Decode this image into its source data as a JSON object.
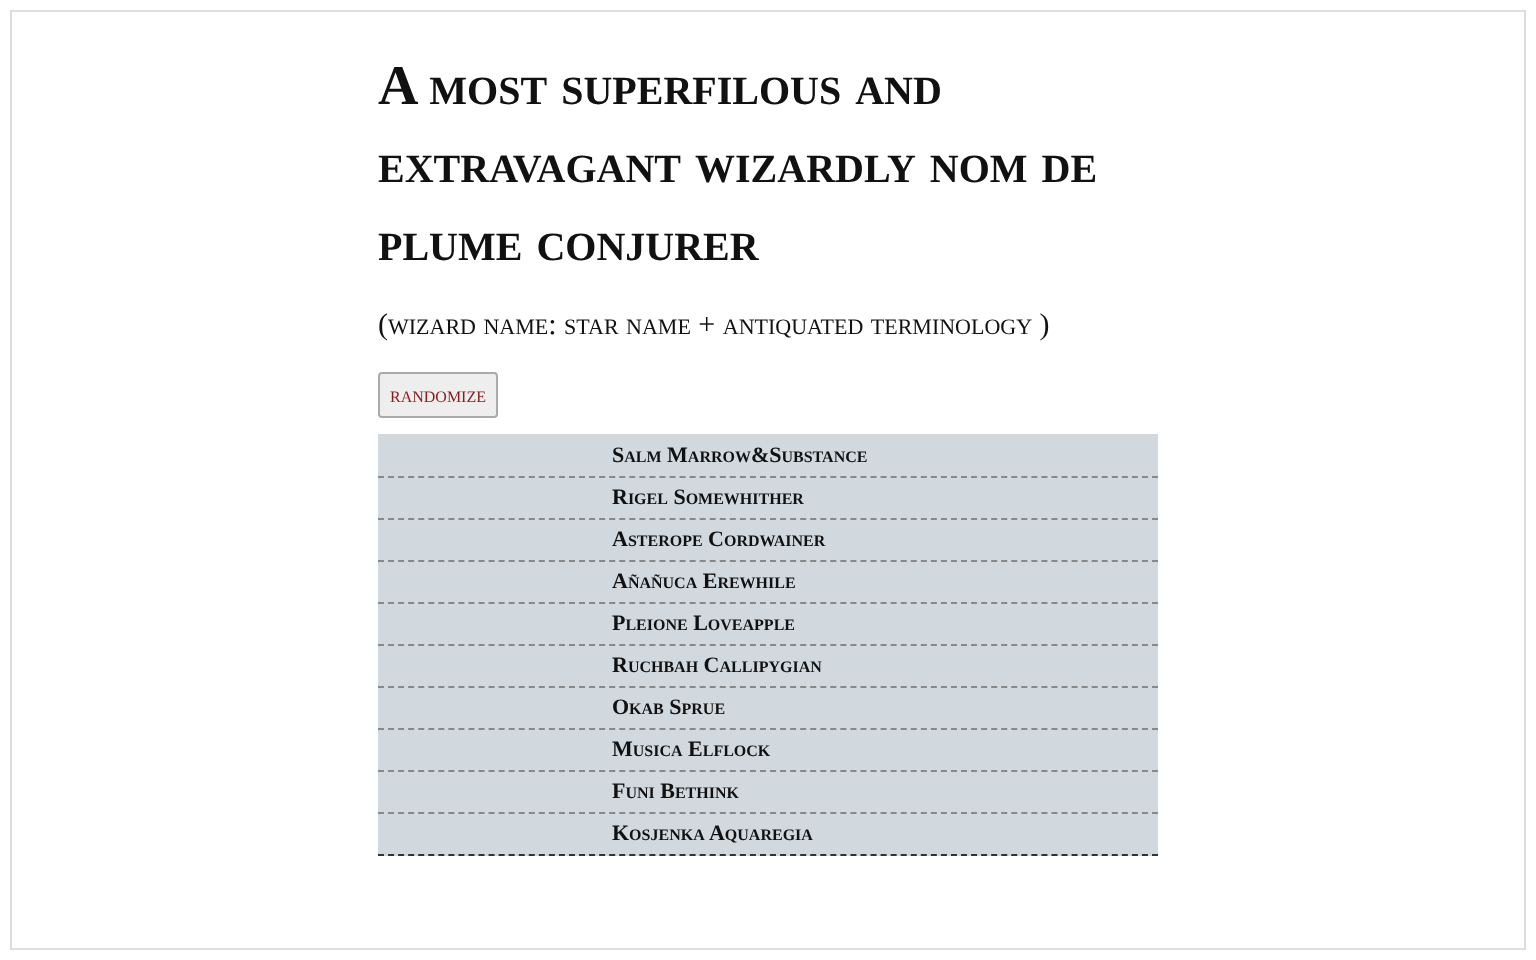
{
  "title": "A most superfilous and extravagant wizardly nom de plume conjurer",
  "subtitle": "(wizard name: star name + antiquated terminology )",
  "button": "randomize",
  "names": [
    "Salm Marrow&Substance",
    "Rigel Somewhither",
    "Asterope Cordwainer",
    "Añañuca Erewhile",
    "Pleione Loveapple",
    "Ruchbah Callipygian",
    "Okab Sprue",
    "Musica Elflock",
    "Funi Bethink",
    "Kosjenka Aquaregia"
  ]
}
